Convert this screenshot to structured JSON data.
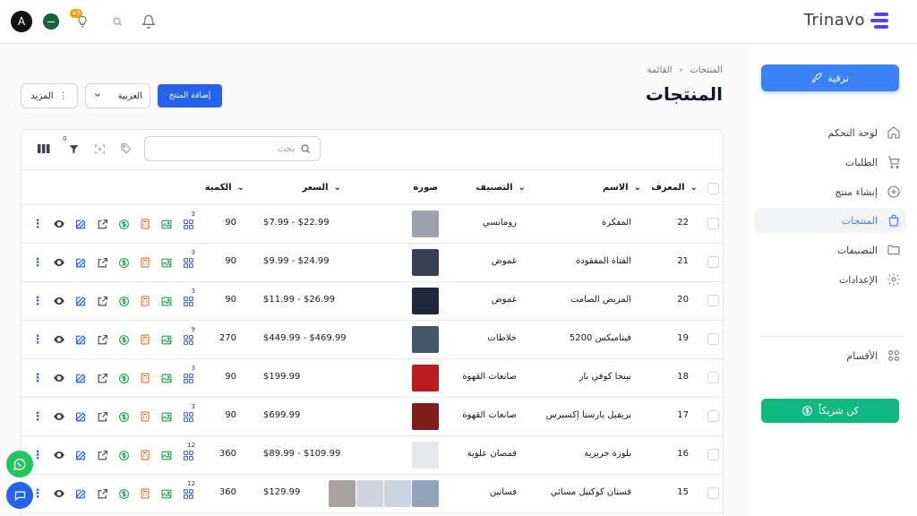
{
  "app": {
    "name": "Trinavo",
    "avatar_initial": "A",
    "notif_count": "+5"
  },
  "colors": {
    "primary": "#3b82f6",
    "success": "#10b981",
    "dark": "#111827"
  },
  "sidebar": {
    "upgrade_label": "ترقية",
    "items": [
      {
        "label": "لوحة التحكم",
        "icon": "home-icon"
      },
      {
        "label": "الطلبات",
        "icon": "cart-icon"
      },
      {
        "label": "إنشاء منتج",
        "icon": "plus-circle-icon"
      },
      {
        "label": "المنتجات",
        "icon": "bag-icon",
        "active": true
      },
      {
        "label": "التصنيفات",
        "icon": "folder-icon"
      },
      {
        "label": "الإعدادات",
        "icon": "gear-icon"
      },
      {
        "label": "الأقسام",
        "icon": "grid-icon"
      }
    ],
    "partner_label": "كن شريكاً"
  },
  "header": {
    "breadcrumb": [
      "المنتجات",
      "القائمة"
    ],
    "title": "المنتجات",
    "add_label": "إضافة المنتج",
    "lang_label": "العربية",
    "more_label": "المزيد"
  },
  "table": {
    "search_placeholder": "بحث",
    "filter_count": "0",
    "columns": [
      "المعرف",
      "الاسم",
      "التصنيف",
      "صورة",
      "السعر",
      "الكمية"
    ],
    "rows": [
      {
        "id": "22",
        "name": "المفكرة",
        "category": "رومانسي",
        "price": "$7.99 - $22.99",
        "qty": "90",
        "variants": "3",
        "images": [
          "#9ca3af"
        ]
      },
      {
        "id": "21",
        "name": "الفتاة المفقودة",
        "category": "غموض",
        "price": "$9.99 - $24.99",
        "qty": "90",
        "variants": "3",
        "images": [
          "#374151"
        ]
      },
      {
        "id": "20",
        "name": "المريض الصامت",
        "category": "غموض",
        "price": "$11.99 - $26.99",
        "qty": "90",
        "variants": "3",
        "images": [
          "#1f2937"
        ]
      },
      {
        "id": "19",
        "name": "فيتاميكس 5200",
        "category": "خلاطات",
        "price": "$449.99 - $469.99",
        "qty": "270",
        "variants": "9",
        "images": [
          "#475569"
        ]
      },
      {
        "id": "18",
        "name": "نينجا كوفي بار",
        "category": "صانعات القهوة",
        "price": "$199.99",
        "qty": "90",
        "variants": "3",
        "images": [
          "#b91c1c"
        ]
      },
      {
        "id": "17",
        "name": "بريفيل بارستا إكسبرس",
        "category": "صانعات القهوة",
        "price": "$699.99",
        "qty": "90",
        "variants": "3",
        "images": [
          "#7f1d1d"
        ]
      },
      {
        "id": "16",
        "name": "بلوزة حريرية",
        "category": "قمصان علوية",
        "price": "$89.99 - $109.99",
        "qty": "360",
        "variants": "12",
        "images": [
          "#e5e7eb"
        ]
      },
      {
        "id": "15",
        "name": "فستان كوكتيل مسائي",
        "category": "فساتين",
        "price": "$129.99",
        "qty": "360",
        "variants": "12",
        "images": [
          "#94a3b8",
          "#cbd5e1",
          "#d1d5db",
          "#a8a29e"
        ]
      }
    ]
  }
}
